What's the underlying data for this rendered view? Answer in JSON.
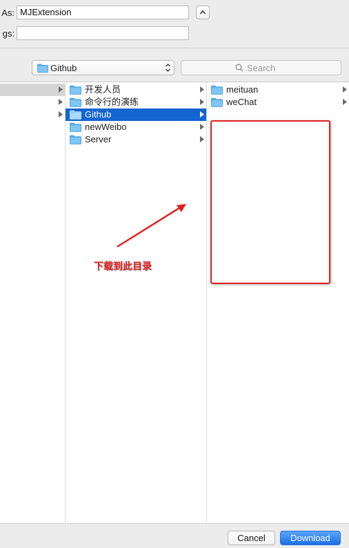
{
  "top": {
    "save_as_label": "As:",
    "save_as_value": "MJExtension",
    "tags_label": "gs:",
    "tags_value": ""
  },
  "location_popup": {
    "label": "Github",
    "icon": "folder-icon"
  },
  "search": {
    "placeholder": "Search",
    "icon": "magnifier-icon"
  },
  "columns": {
    "col1": {
      "items": [
        {
          "label": "",
          "state": "highlighted",
          "has_children": true
        },
        {
          "label": "",
          "has_children": true
        },
        {
          "label": "",
          "has_children": true
        }
      ]
    },
    "col2": {
      "items": [
        {
          "label": "开发人员",
          "has_children": true
        },
        {
          "label": "命令行的演练",
          "has_children": true
        },
        {
          "label": "Github",
          "has_children": true,
          "selected": true
        },
        {
          "label": "newWeibo",
          "has_children": true
        },
        {
          "label": "Server",
          "has_children": true
        }
      ]
    },
    "col3": {
      "items": [
        {
          "label": "meituan",
          "has_children": true
        },
        {
          "label": "weChat",
          "has_children": true
        }
      ]
    }
  },
  "annotation": {
    "text": "下载到此目录",
    "color": "#e02020"
  },
  "buttons": {
    "cancel": "Cancel",
    "download": "Download"
  },
  "colors": {
    "selection": "#1464d2",
    "accent": "#1b70e8",
    "folder": "#5fb3f0"
  }
}
